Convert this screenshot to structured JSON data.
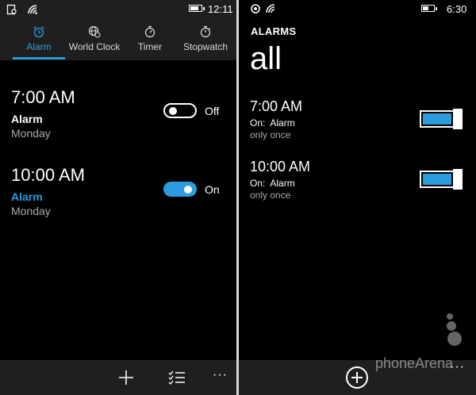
{
  "left": {
    "status": {
      "time": "12:11",
      "battery_level": 0.8
    },
    "tabs": [
      {
        "label": "Alarm",
        "icon": "alarm-clock-icon",
        "active": true
      },
      {
        "label": "World Clock",
        "icon": "globe-icon",
        "active": false
      },
      {
        "label": "Timer",
        "icon": "timer-icon",
        "active": false
      },
      {
        "label": "Stopwatch",
        "icon": "stopwatch-icon",
        "active": false
      }
    ],
    "alarms": [
      {
        "time": "7:00 AM",
        "name": "Alarm",
        "days": "Monday",
        "state_label": "Off",
        "enabled": false
      },
      {
        "time": "10:00 AM",
        "name": "Alarm",
        "days": "Monday",
        "state_label": "On",
        "enabled": true
      }
    ],
    "appbar": {
      "add_icon": "plus-icon",
      "select_icon": "checklist-icon",
      "more": "···"
    }
  },
  "right": {
    "status": {
      "time": "6:30",
      "battery_level": 0.55
    },
    "header": "ALARMS",
    "title": "all",
    "alarms": [
      {
        "time": "7:00 AM",
        "status": "On:  Alarm",
        "repeat": "only once",
        "enabled": true
      },
      {
        "time": "10:00 AM",
        "status": "On:  Alarm",
        "repeat": "only once",
        "enabled": true
      }
    ],
    "appbar": {
      "add_icon": "circle-plus-icon",
      "more": "···"
    },
    "watermark": "phoneArena"
  },
  "colors": {
    "accent": "#2d9cde",
    "background": "#000000",
    "appbar": "#1f1f1f",
    "secondary_text": "#a8a8a8"
  }
}
